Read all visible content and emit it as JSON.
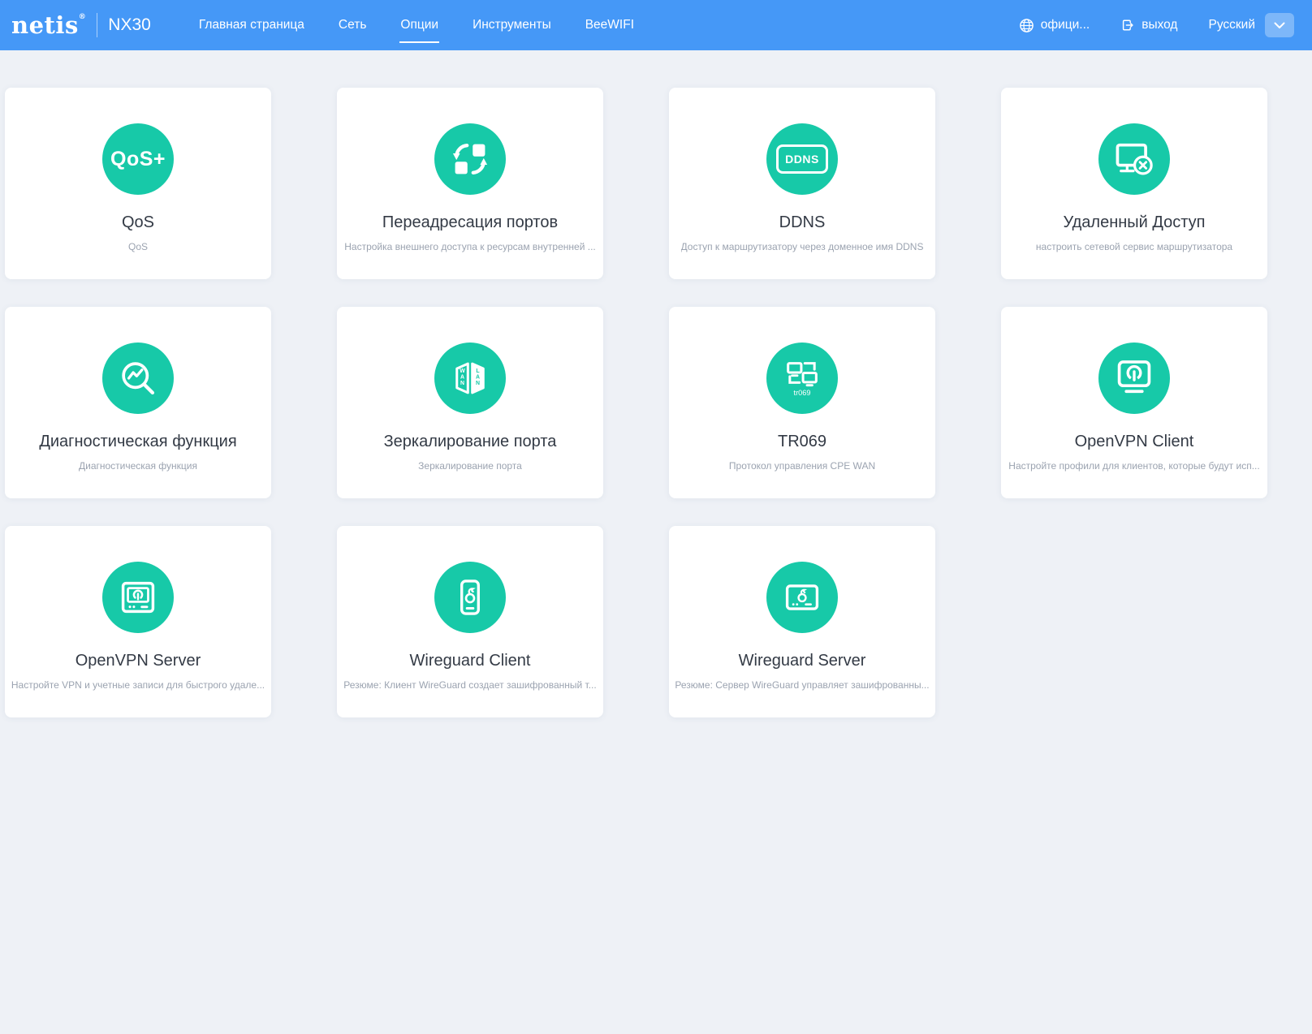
{
  "topbar": {
    "brand": "netis",
    "brand_sup": "®",
    "model": "NX30",
    "nav": [
      {
        "label": "Главная страница",
        "active": false
      },
      {
        "label": "Сеть",
        "active": false
      },
      {
        "label": "Опции",
        "active": true
      },
      {
        "label": "Инструменты",
        "active": false
      },
      {
        "label": "BeeWIFI",
        "active": false
      }
    ],
    "official_label": "офици...",
    "logout_label": "выход",
    "language": "Русский"
  },
  "cards": [
    {
      "title": "QoS",
      "subtitle": "QoS",
      "icon": "qos-icon",
      "icon_text": "QoS+"
    },
    {
      "title": "Переадресация портов",
      "subtitle": "Настройка внешнего доступа к ресурсам внутренней ...",
      "icon": "port-forwarding-icon"
    },
    {
      "title": "DDNS",
      "subtitle": "Доступ к маршрутизатору через доменное имя DDNS",
      "icon": "ddns-icon",
      "icon_text": "DDNS"
    },
    {
      "title": "Удаленный Доступ",
      "subtitle": "настроить сетевой сервис маршрутизатора",
      "icon": "remote-access-icon"
    },
    {
      "title": "Диагностическая функция",
      "subtitle": "Диагностическая функция",
      "icon": "diagnostics-icon"
    },
    {
      "title": "Зеркалирование порта",
      "subtitle": "Зеркалирование порта",
      "icon": "port-mirroring-icon",
      "icon_text_left": "WAN",
      "icon_text_right": "LAN"
    },
    {
      "title": "TR069",
      "subtitle": "Протокол управления CPE WAN",
      "icon": "tr069-icon",
      "icon_text": "tr069"
    },
    {
      "title": "OpenVPN Client",
      "subtitle": "Настройте профили для клиентов, которые будут исп...",
      "icon": "openvpn-client-icon"
    },
    {
      "title": "OpenVPN Server",
      "subtitle": "Настройте VPN и учетные записи для быстрого удале...",
      "icon": "openvpn-server-icon"
    },
    {
      "title": "Wireguard Client",
      "subtitle": "Резюме: Клиент WireGuard создает зашифрованный т...",
      "icon": "wireguard-client-icon"
    },
    {
      "title": "Wireguard Server",
      "subtitle": "Резюме: Сервер WireGuard управляет зашифрованны...",
      "icon": "wireguard-server-icon"
    }
  ],
  "colors": {
    "topbar_blue": "#4598F7",
    "accent_teal": "#17C9A8",
    "page_bg": "#EEF1F6"
  }
}
